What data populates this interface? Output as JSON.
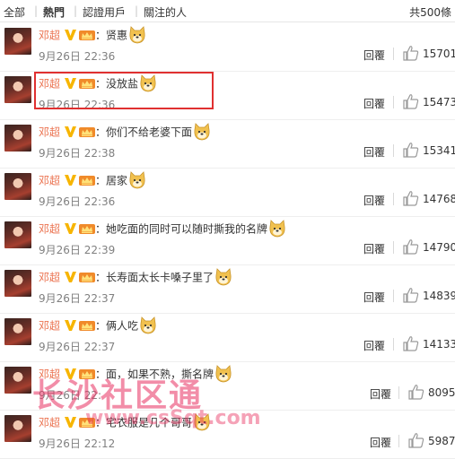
{
  "filter": {
    "tabs": [
      {
        "label": "全部",
        "active": false
      },
      {
        "label": "熱門",
        "active": true
      },
      {
        "label": "認證用戶",
        "active": false
      },
      {
        "label": "關注的人",
        "active": false
      }
    ],
    "total": "共500條"
  },
  "comments": [
    {
      "user": "邓超",
      "text": "贤惠",
      "time": "9月26日 22:36",
      "reply": "回覆",
      "likes": "15701"
    },
    {
      "user": "邓超",
      "text": "没放盐",
      "time": "9月26日 22:36",
      "reply": "回覆",
      "likes": "15473"
    },
    {
      "user": "邓超",
      "text": "你们不给老婆下面",
      "time": "9月26日 22:38",
      "reply": "回覆",
      "likes": "15341"
    },
    {
      "user": "邓超",
      "text": "居家",
      "time": "9月26日 22:36",
      "reply": "回覆",
      "likes": "14768"
    },
    {
      "user": "邓超",
      "text": "她吃面的同时可以随时撕我的名牌",
      "time": "9月26日 22:39",
      "reply": "回覆",
      "likes": "14790"
    },
    {
      "user": "邓超",
      "text": "长寿面太长卡嗓子里了",
      "time": "9月26日 22:37",
      "reply": "回覆",
      "likes": "14839"
    },
    {
      "user": "邓超",
      "text": "俩人吃",
      "time": "9月26日 22:37",
      "reply": "回覆",
      "likes": "14133"
    },
    {
      "user": "邓超",
      "text": "面，如果不熟，撕名牌",
      "time": "9月26日 22:",
      "reply": "回覆",
      "likes": "8095"
    },
    {
      "user": "邓超",
      "text": "宅衣服是几个哥哥",
      "time": "9月26日 22:12",
      "reply": "回覆",
      "likes": "5987"
    }
  ],
  "watermark": {
    "title": "长沙社区通",
    "url": "www.csSqt.com"
  },
  "colors": {
    "username": "#eb7350",
    "highlight": "#e03030",
    "watermark": "#e83060"
  },
  "icons": {
    "verified": "verified-v-icon",
    "member": "member-crown-icon",
    "emoji": "doge-emoji-icon",
    "like": "thumbs-up-icon"
  }
}
